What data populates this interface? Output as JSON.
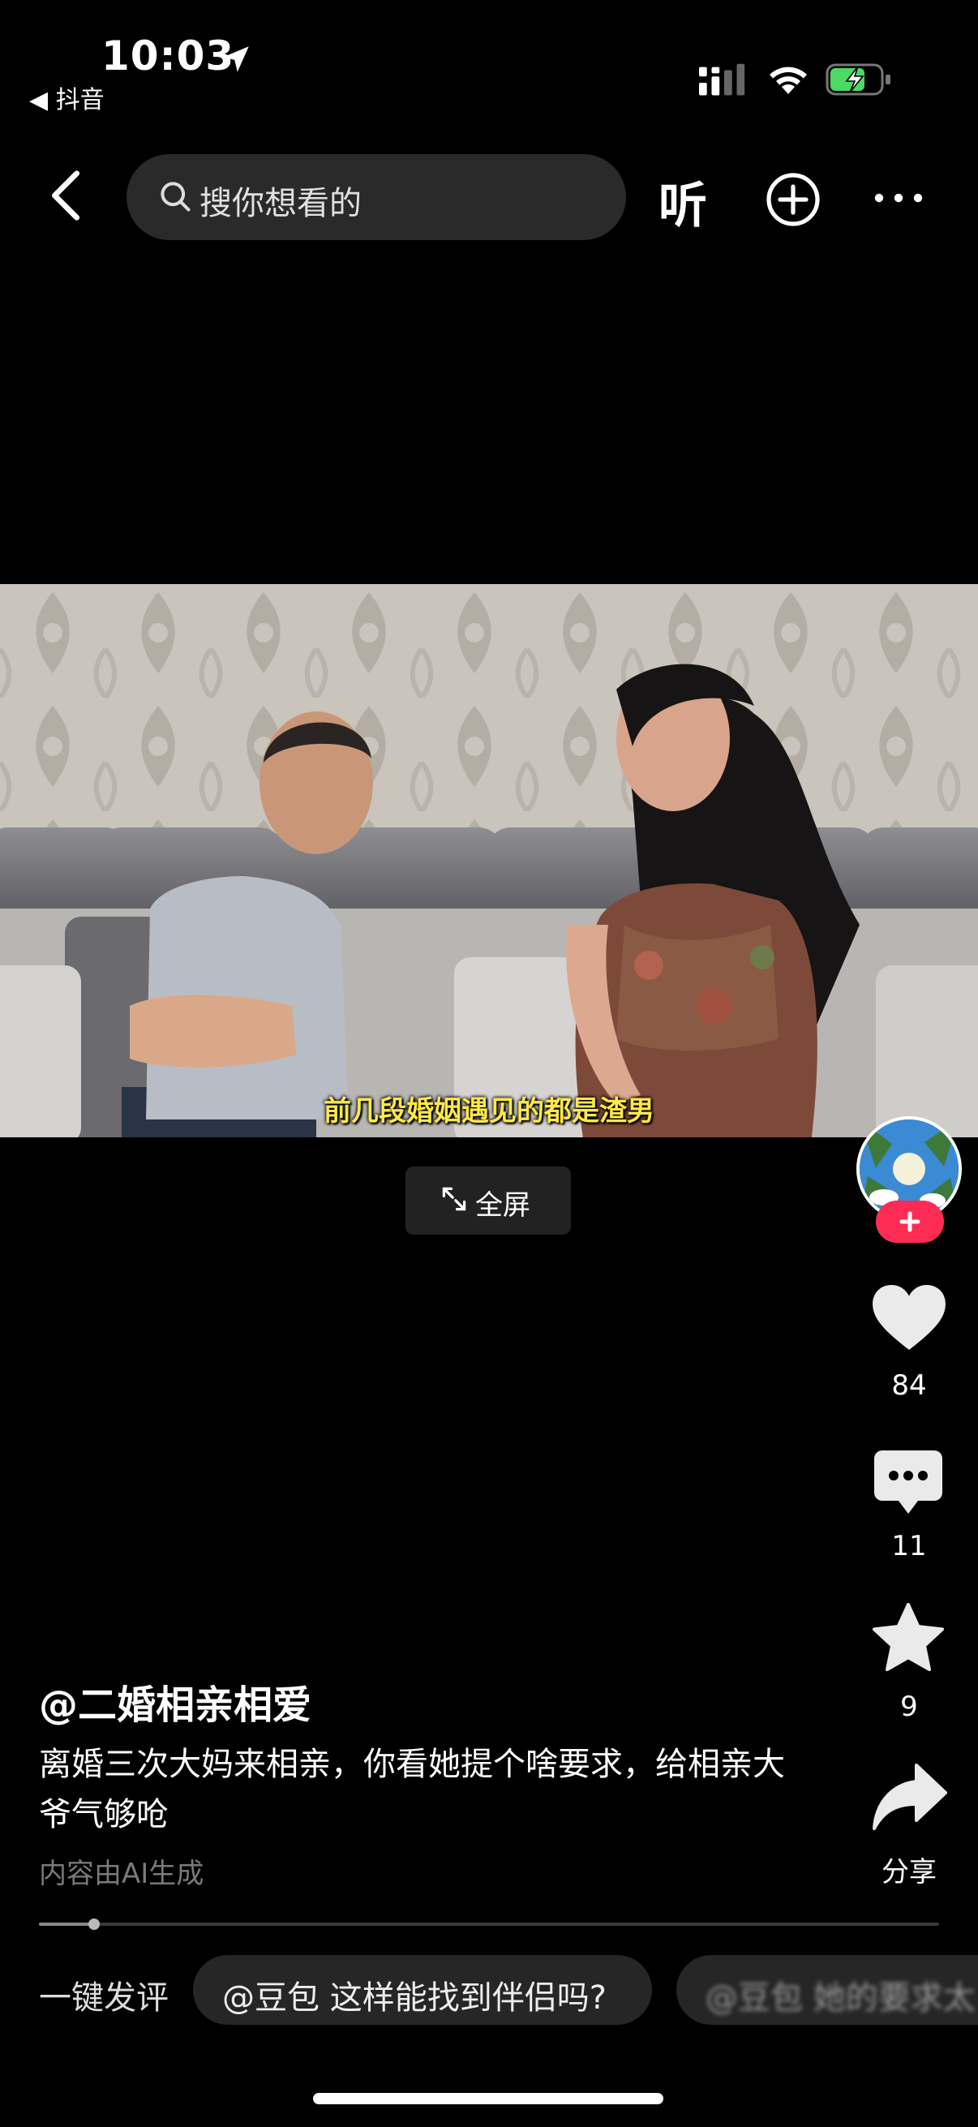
{
  "status_bar": {
    "time": "10:03",
    "back_app": "◀ 抖音",
    "battery_color": "#4cd964"
  },
  "top_nav": {
    "search_placeholder": "搜你想看的",
    "listen_label": "听"
  },
  "video": {
    "subtitle": "前几段婚姻遇见的都是渣男",
    "fullscreen_label": "全屏"
  },
  "actions": {
    "likes": "84",
    "comments": "11",
    "favorites": "9",
    "share_label": "分享",
    "follow_color": "#fe2c55"
  },
  "caption": {
    "author": "@二婚相亲相爱",
    "description": "离婚三次大妈来相亲，你看她提个啥要求，给相亲大爷气够呛",
    "ai_note": "内容由AI生成"
  },
  "playback": {
    "progress_fraction": 0.061
  },
  "quick_comment": {
    "label": "一键发评",
    "chips": [
      "@豆包 这样能找到伴侣吗?",
      "@豆包 她的要求太"
    ]
  }
}
